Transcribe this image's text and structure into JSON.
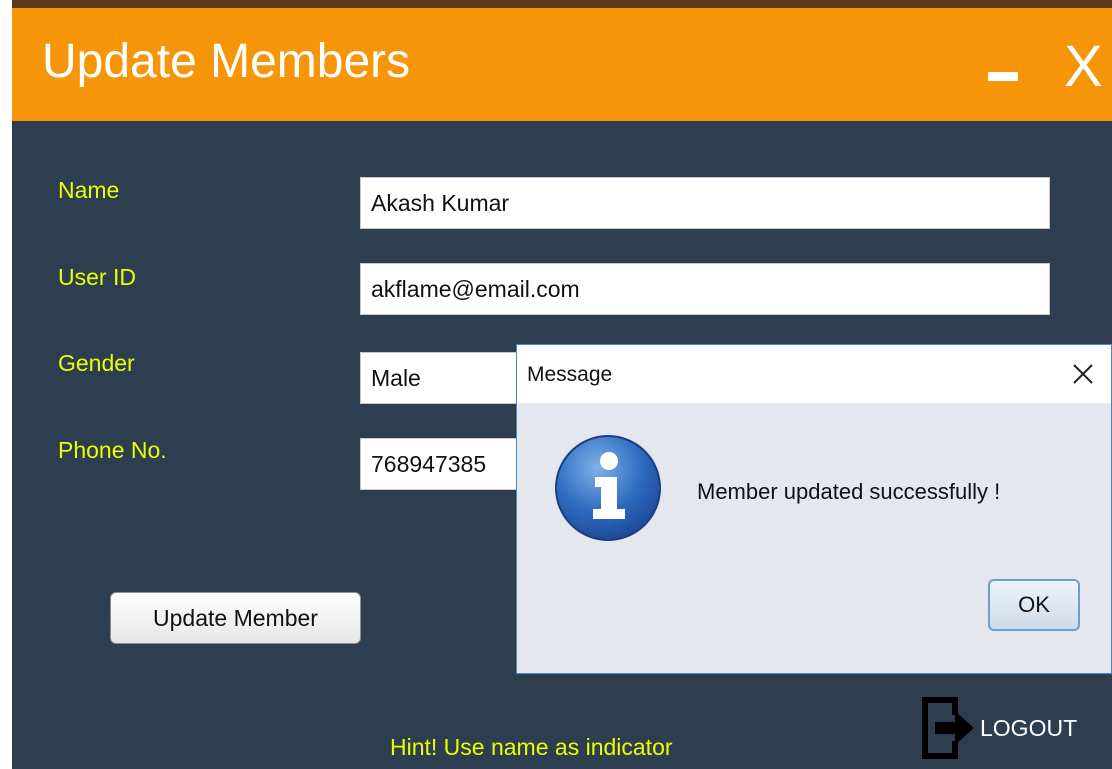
{
  "window": {
    "title": "Update Members",
    "minimize_label": "-",
    "close_label": "X"
  },
  "form": {
    "name_label": "Name",
    "name_value": "Akash Kumar",
    "userid_label": "User ID",
    "userid_value": "akflame@email.com",
    "gender_label": "Gender",
    "gender_value": "Male",
    "phone_label": "Phone No.",
    "phone_value": "768947385",
    "update_button": "Update Member",
    "hint": "Hint! Use name as indicator"
  },
  "logout": {
    "label": "LOGOUT",
    "icon": "logout-icon"
  },
  "dialog": {
    "title": "Message",
    "message": "Member updated successfully !",
    "ok_label": "OK",
    "icon": "info-icon"
  },
  "colors": {
    "header": "#f79508",
    "background": "#2c3e50",
    "label": "#eaff00"
  }
}
